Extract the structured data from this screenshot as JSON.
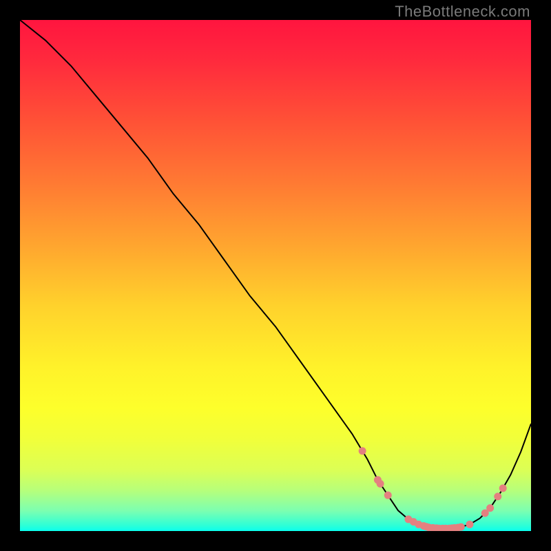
{
  "watermark": "TheBottleneck.com",
  "chart_data": {
    "type": "line",
    "title": "",
    "xlabel": "",
    "ylabel": "",
    "xlim": [
      0,
      100
    ],
    "ylim": [
      0,
      100
    ],
    "x": [
      0,
      5,
      10,
      15,
      20,
      25,
      30,
      35,
      40,
      45,
      50,
      55,
      60,
      65,
      68,
      70,
      72,
      74,
      76,
      78,
      80,
      82,
      84,
      86,
      88,
      90,
      92,
      94,
      96,
      98,
      100
    ],
    "values": [
      100,
      96,
      91,
      85,
      79,
      73,
      66,
      60,
      53,
      46,
      40,
      33,
      26,
      19,
      14,
      10,
      7,
      4,
      2.3,
      1.3,
      0.7,
      0.5,
      0.5,
      0.7,
      1.3,
      2.5,
      4.5,
      7.5,
      11,
      15.5,
      21
    ],
    "markers_x": [
      67,
      70,
      70.5,
      72,
      76,
      77,
      78,
      79,
      79.5,
      80,
      80.8,
      81.5,
      82,
      82.7,
      83.3,
      84,
      84.5,
      85,
      85.7,
      86.3,
      88,
      91,
      92,
      93.5,
      94.5
    ],
    "marker_color": "#e48080",
    "curve_color": "#000000",
    "curve_width": 2
  }
}
